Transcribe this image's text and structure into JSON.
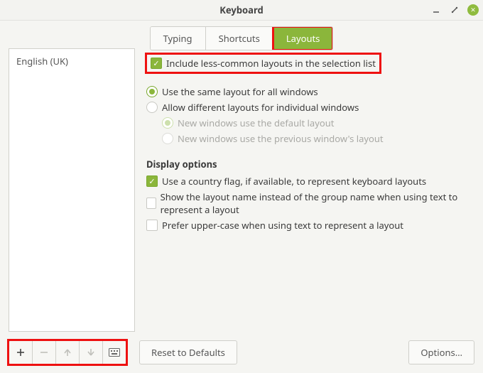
{
  "window": {
    "title": "Keyboard"
  },
  "tabs": {
    "typing": "Typing",
    "shortcuts": "Shortcuts",
    "layouts": "Layouts"
  },
  "sidebar": {
    "items": [
      "English (UK)"
    ]
  },
  "main": {
    "include_less_common": "Include less-common layouts in the selection list",
    "same_layout": "Use the same layout for all windows",
    "allow_diff": "Allow different layouts for individual windows",
    "new_default": "New windows use the default layout",
    "new_previous": "New windows use the previous window's layout",
    "display_options_header": "Display options",
    "country_flag": "Use a country flag, if available,  to represent keyboard layouts",
    "show_layout_name": "Show the layout name instead of the group name when using text to represent a layout",
    "prefer_upper": "Prefer upper-case when using text to represent a layout"
  },
  "buttons": {
    "reset": "Reset to Defaults",
    "options": "Options…"
  }
}
